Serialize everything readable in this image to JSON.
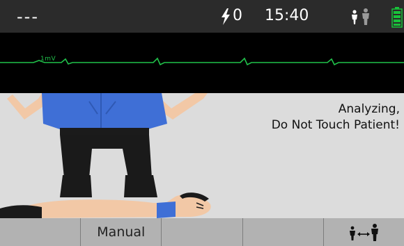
{
  "status_bar": {
    "heart_rate": "---",
    "shock_count": "0",
    "time": "15:40",
    "battery_color": "#19c23a"
  },
  "ecg": {
    "calibration_label": "1mV",
    "trace_color": "#21c24b"
  },
  "prompt": {
    "line1": "Analyzing,",
    "line2": "Do Not Touch Patient!"
  },
  "softkeys": [
    {
      "label": ""
    },
    {
      "label": "Manual"
    },
    {
      "label": ""
    },
    {
      "label": ""
    },
    {
      "label": "",
      "icon": "adult-child-switch-icon"
    }
  ]
}
